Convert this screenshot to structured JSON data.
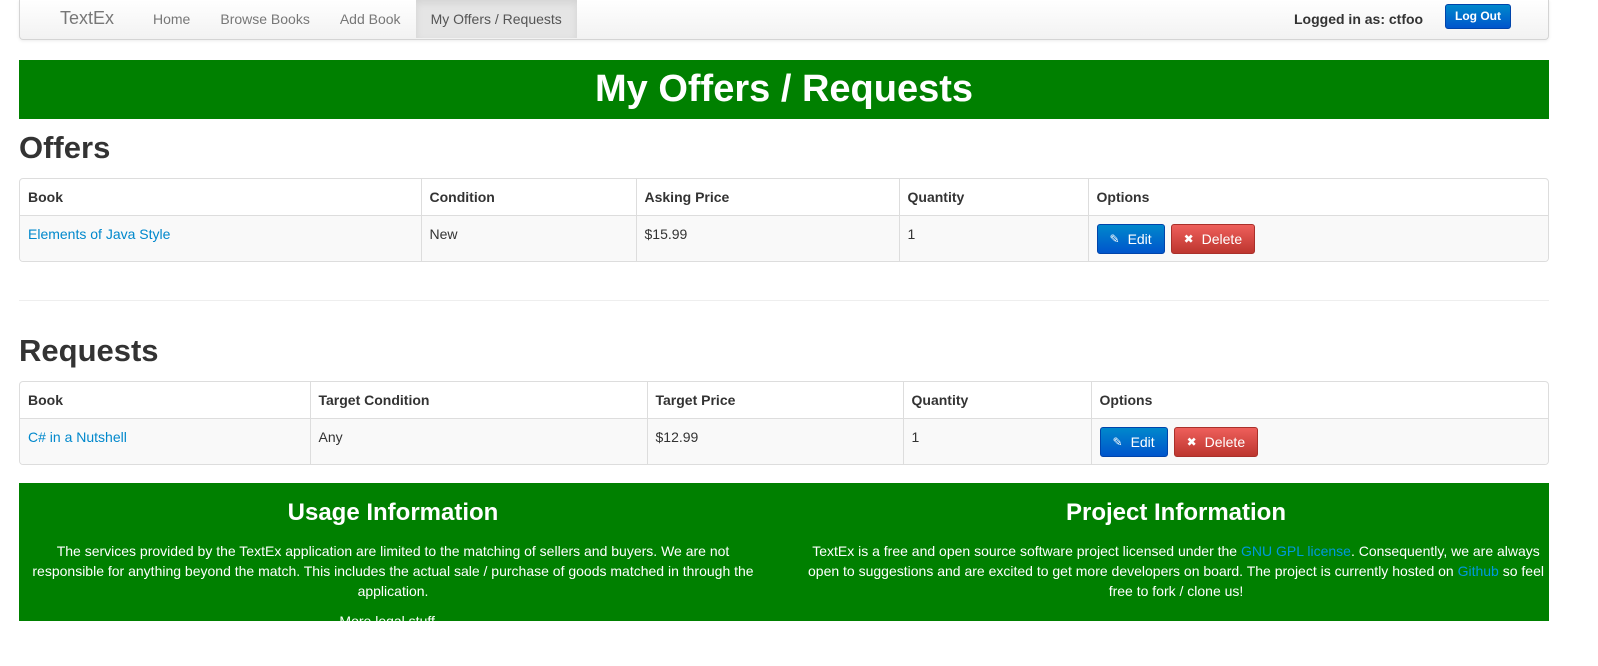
{
  "nav": {
    "brand": "TextEx",
    "items": [
      "Home",
      "Browse Books",
      "Add Book",
      "My Offers / Requests"
    ],
    "logged_in": "Logged in as: ctfoo",
    "logout": "Log Out"
  },
  "banner": {
    "title": "My Offers / Requests"
  },
  "offers": {
    "heading": "Offers",
    "columns": [
      "Book",
      "Condition",
      "Asking Price",
      "Quantity",
      "Options"
    ],
    "rows": [
      {
        "book": "Elements of Java Style",
        "condition": "New",
        "price": "$15.99",
        "quantity": "1"
      }
    ]
  },
  "requests": {
    "heading": "Requests",
    "columns": [
      "Book",
      "Target Condition",
      "Target Price",
      "Quantity",
      "Options"
    ],
    "rows": [
      {
        "book": "C# in a Nutshell",
        "condition": "Any",
        "price": "$12.99",
        "quantity": "1"
      }
    ]
  },
  "buttons": {
    "edit": "Edit",
    "delete": "Delete",
    "edit_icon": "edit-icon",
    "delete_icon": "close-icon"
  },
  "footer": {
    "usage": {
      "title": "Usage Information",
      "text": "The services provided by the TextEx application are limited to the matching of sellers and buyers. We are not responsible for anything beyond the match. This includes the actual sale / purchase of goods matched in through the application.",
      "more": "More legal stuff..."
    },
    "project": {
      "title": "Project Information",
      "text_1": "TextEx is a free and open source software project licensed under the ",
      "link_1": "GNU GPL license",
      "text_2": ". Consequently, we are always open to suggestions and are excited to get more developers on board. The project is currently hosted on ",
      "link_2": "Github",
      "text_3": " so feel free to fork / clone us!"
    }
  },
  "colors": {
    "banner": "#008000",
    "primary": "#0088cc",
    "danger": "#da4f49"
  }
}
